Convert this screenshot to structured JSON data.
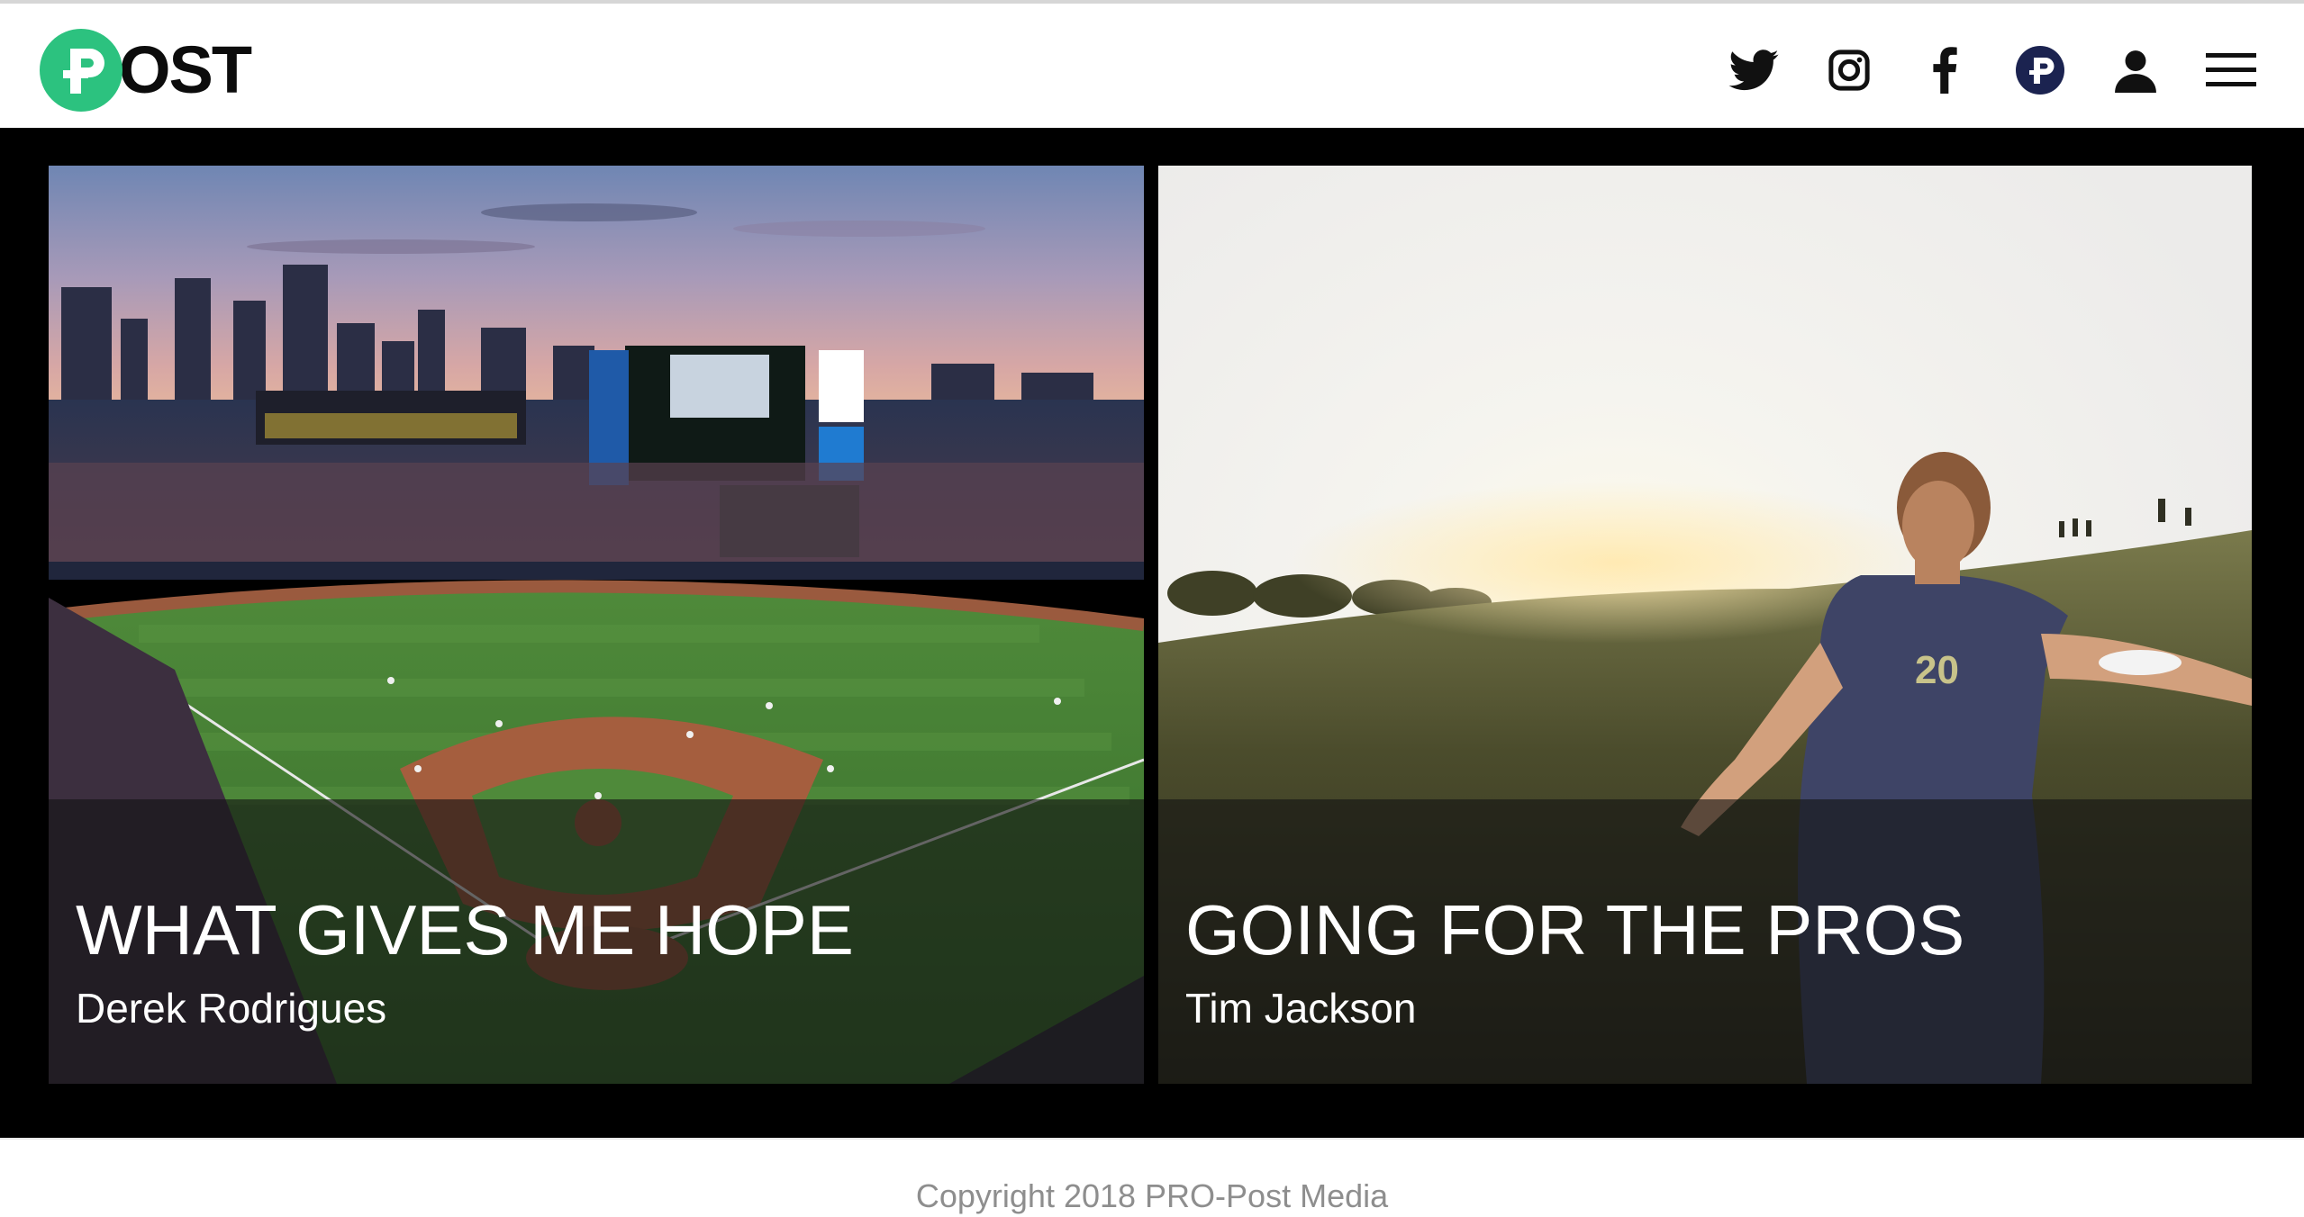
{
  "header": {
    "logo": {
      "mark_letter": "P",
      "text": "OST",
      "mark_color": "#2cc27f"
    },
    "icons": [
      "twitter-icon",
      "instagram-icon",
      "facebook-icon",
      "pro-post-icon",
      "user-icon",
      "menu-icon"
    ]
  },
  "articles": [
    {
      "title": "WHAT GIVES ME HOPE",
      "author": "Derek Rodrigues",
      "image": "baseball-stadium-at-dusk"
    },
    {
      "title": "GOING FOR THE PROS",
      "author": "Tim Jackson",
      "image": "frisbee-player-on-hill-at-sunset"
    }
  ],
  "footer": {
    "copyright": "Copyright 2018 PRO-Post Media"
  }
}
